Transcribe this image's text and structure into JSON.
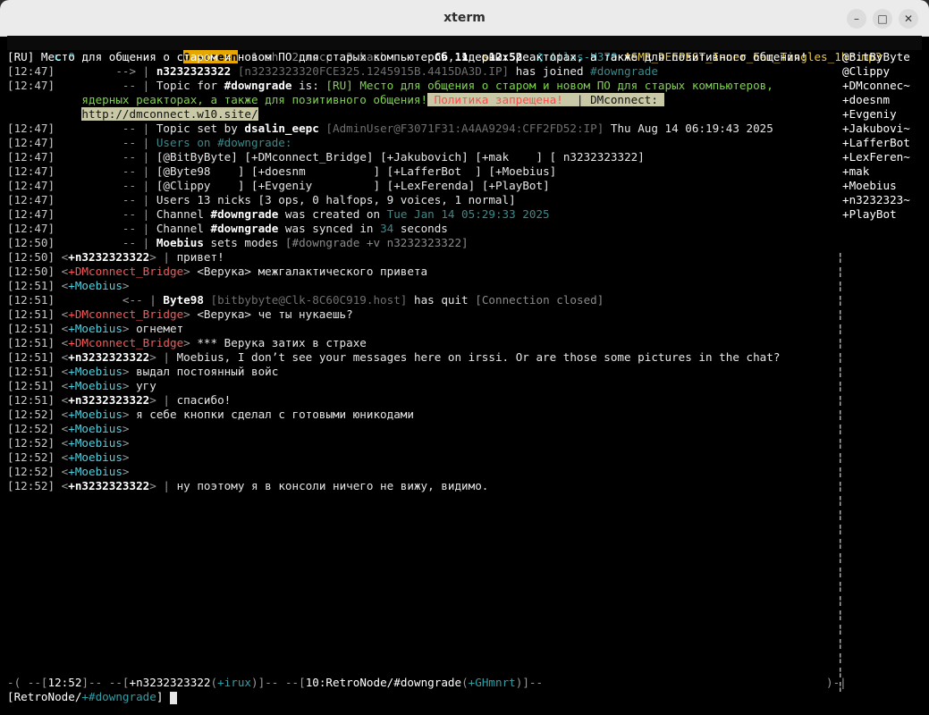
{
  "window": {
    "title": "xterm",
    "min": "–",
    "max": "□",
    "close": "✕"
  },
  "status": {
    "left": "0",
    "screen_tab": "0 screen",
    "tab1": "1 sh",
    "tab2": "2 mocp",
    "tab3": "3 bash",
    "day": "Сб 11",
    "clock": "12:52",
    "host": "Atlas-H370",
    "music": "ASMR_DEEPEST_Inner_Ear_Tingles_1hr.mp3"
  },
  "lines": {
    "l0": "[RU] Место для общения о старом и новом ПО для старых компьютеров, ядерных реакторах, а также для позитивного общения!",
    "l1_ts": "[12:47]",
    "l1_arrow": "-->",
    "l1_nick": "n3232323322",
    "l1_host": "[n3232323320FCE325.1245915B.4415DA3D.IP]",
    "l1_mid": "has joined",
    "l1_chan": "#downgrade",
    "l2_ts": "[12:47]",
    "l2_arrow": "--",
    "l2_pre": "Topic for ",
    "l2_chan": "#downgrade",
    "l2_is": " is: ",
    "l2_topic1": "[RU] Место для общения о старом и новом ПО для старых компьютеров,",
    "l3_topic2": "ядерных реакторах, а также для позитивного общения!",
    "l3_warn": " Политика запрещена! ",
    "l3_dm": " | DMconnect: ",
    "l4_url": "http://dmconnect.w10.site/",
    "l5_ts": "[12:47]",
    "l5_arrow": "--",
    "l5_pre": "Topic set by ",
    "l5_nick": "dsalin_eepc",
    "l5_host": "[AdminUser@F3071F31:A4AA9294:CFF2FD52:IP]",
    "l5_date": "Thu Aug 14 06:19:43 2025",
    "l6_ts": "[12:47]",
    "l6_arrow": "--",
    "l6_text": "Users on #downgrade:",
    "l7_ts": "[12:47]",
    "l7_a": "[@BitByByte]",
    "l7_b": "[+DMconnect_Bridge]",
    "l7_c": "[+Jakubovich]",
    "l7_d": "[+mak    ]",
    "l7_e": "[ n3232323322]",
    "l8_ts": "[12:47]",
    "l8_a": "[@Byte98    ]",
    "l8_b": "[+doesnm          ]",
    "l8_c": "[+LafferBot  ]",
    "l8_d": "[+Moebius]",
    "l9_ts": "[12:47]",
    "l9_a": "[@Clippy    ]",
    "l9_b": "[+Evgeniy         ]",
    "l9_c": "[+LexFerenda]",
    "l9_d": "[+PlayBot]",
    "l10_ts": "[12:47]",
    "l10_text": "Users 13 nicks [3 ops, 0 halfops, 9 voices, 1 normal]",
    "l11_ts": "[12:47]",
    "l11_pre": "Channel ",
    "l11_chan": "#downgrade",
    "l11_mid": " was created on ",
    "l11_date": "Tue Jan 14 05:29:33 2025",
    "l12_ts": "[12:47]",
    "l12_pre": "Channel ",
    "l12_chan": "#downgrade",
    "l12_mid": " was synced in ",
    "l12_num": "34",
    "l12_end": " seconds",
    "l13_ts": "[12:50]",
    "l13_nick": "Moebius",
    "l13_mid": " sets modes ",
    "l13_modes": "[#downgrade +v n3232323322]",
    "m1_ts": "[12:50]",
    "m1_nick": "+n3232323322",
    "m1_text": "привет!",
    "m2_ts": "[12:50]",
    "m2_nick": "+DMconnect_Bridge",
    "m2_text": "<Верука> межгалактического привета",
    "m3_ts": "[12:51]",
    "m3_nick": "+Moebius",
    "m3_text": "",
    "m4_ts": "[12:51]",
    "m4_nick": "Byte98",
    "m4_host": "[bitbybyte@Clk-8C60C919.host]",
    "m4_mid": "has quit",
    "m4_reason": "[Connection closed]",
    "m5_ts": "[12:51]",
    "m5_nick": "+DMconnect_Bridge",
    "m5_text": "<Верука> че ты нукаешь?",
    "m6_ts": "[12:51]",
    "m6_nick": "+Moebius",
    "m6_text": "огнемет",
    "m7_ts": "[12:51]",
    "m7_nick": "+DMconnect_Bridge",
    "m7_text": "*** Верука затих в страхе",
    "m8_ts": "[12:51]",
    "m8_nick": "+n3232323322",
    "m8_text": "Moebius, I don’t see your messages here on irssi. Or are those some pictures in the chat?",
    "m9_ts": "[12:51]",
    "m9_nick": "+Moebius",
    "m9_text": "выдал постоянный войс",
    "m10_ts": "[12:51]",
    "m10_nick": "+Moebius",
    "m10_text": "yгу",
    "m11_ts": "[12:51]",
    "m11_nick": "+n3232323322",
    "m11_text": "спасибо!",
    "m12_ts": "[12:52]",
    "m12_nick": "+Moebius",
    "m12_text": "я себе кнопки сделал с готовыми юникодами",
    "m13_ts": "[12:52]",
    "m13_nick": "+Moebius",
    "m14_ts": "[12:52]",
    "m14_nick": "+Moebius",
    "m15_ts": "[12:52]",
    "m15_nick": "+Moebius",
    "m16_ts": "[12:52]",
    "m16_nick": "+Moebius",
    "m17_ts": "[12:52]",
    "m17_nick": "+n3232323322",
    "m17_text": "ну поэтому я в консоли ничего не вижу, видимо."
  },
  "nicklist": [
    "@BitByByte",
    "@Clippy",
    "+DMconnec~",
    "+doesnm",
    "+Evgeniy",
    "+Jakubovi~",
    "+LafferBot",
    "+LexFeren~",
    "+mak",
    "+Moebius",
    "+n3232323~",
    "+PlayBot"
  ],
  "bottom": {
    "bar_pre": "-( --[",
    "bar_time": "12:52",
    "bar_mid1": "]-- --[",
    "bar_nick": "+n3232323322",
    "bar_paren1": "(",
    "bar_umode": "+irux",
    "bar_paren2": ")",
    "bar_mid2": "]-- --[",
    "bar_win": "10:RetroNode/#downgrade",
    "bar_paren3": "(",
    "bar_cmode": "+GHmnrt",
    "bar_end": ")]--",
    "bar_right": ")-|",
    "prompt_pre": "[RetroNode/",
    "prompt_chan": "+#downgrade",
    "prompt_end": "]"
  },
  "colors": {
    "status_badge": "#e6a800",
    "nick_cyan": "#4fd0e0",
    "nick_red": "#ff5555",
    "topic_green": "#7cd44a"
  }
}
